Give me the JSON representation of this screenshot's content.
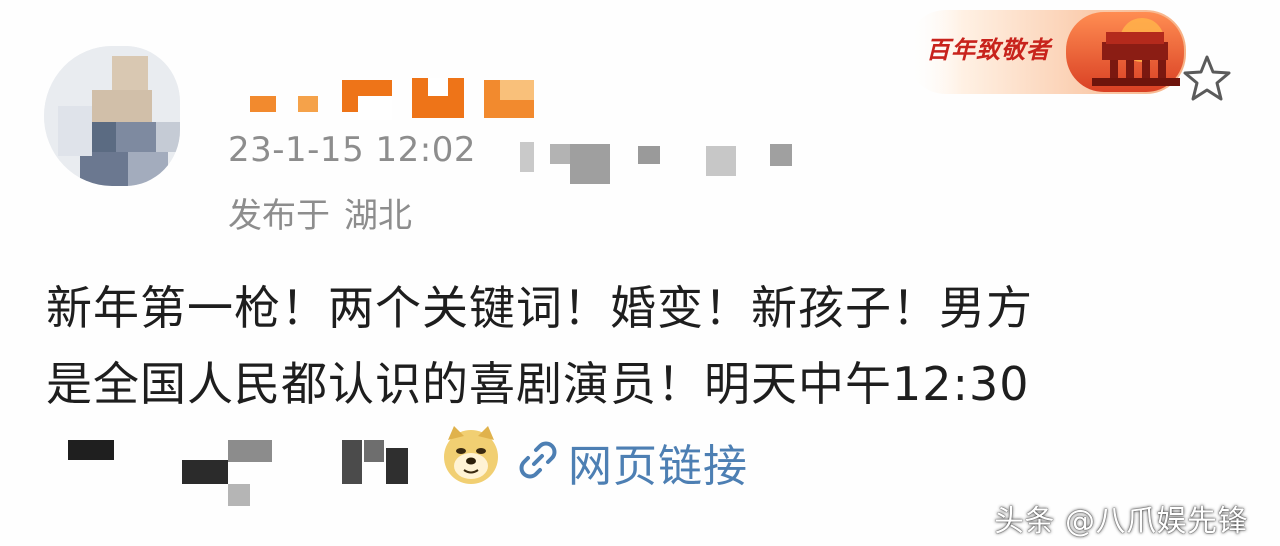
{
  "post": {
    "timestamp": "23-1-15 12:02",
    "location_prefix": "发布于",
    "location": "湖北",
    "content_lines": [
      "新年第一枪！两个关键词！婚变！新孩子！男方",
      "是全国人民都认识的喜剧演员！明天中午12:30"
    ],
    "link_label": "网页链接",
    "badge_text": "百年致敬者"
  },
  "watermark": {
    "text": "头条 @八爪娱先锋"
  },
  "icons": {
    "avatar": "avatar-pixelated",
    "dog": "doge-emoji-icon",
    "link": "link-icon",
    "star": "star-icon",
    "badge": "centenary-badge-icon"
  },
  "colors": {
    "meta_gray": "#8d8d8d",
    "content_text": "#1e1e1e",
    "link_blue": "#4d7fb3",
    "badge_red": "#c8231c",
    "username_orange": "#f07d1a"
  }
}
